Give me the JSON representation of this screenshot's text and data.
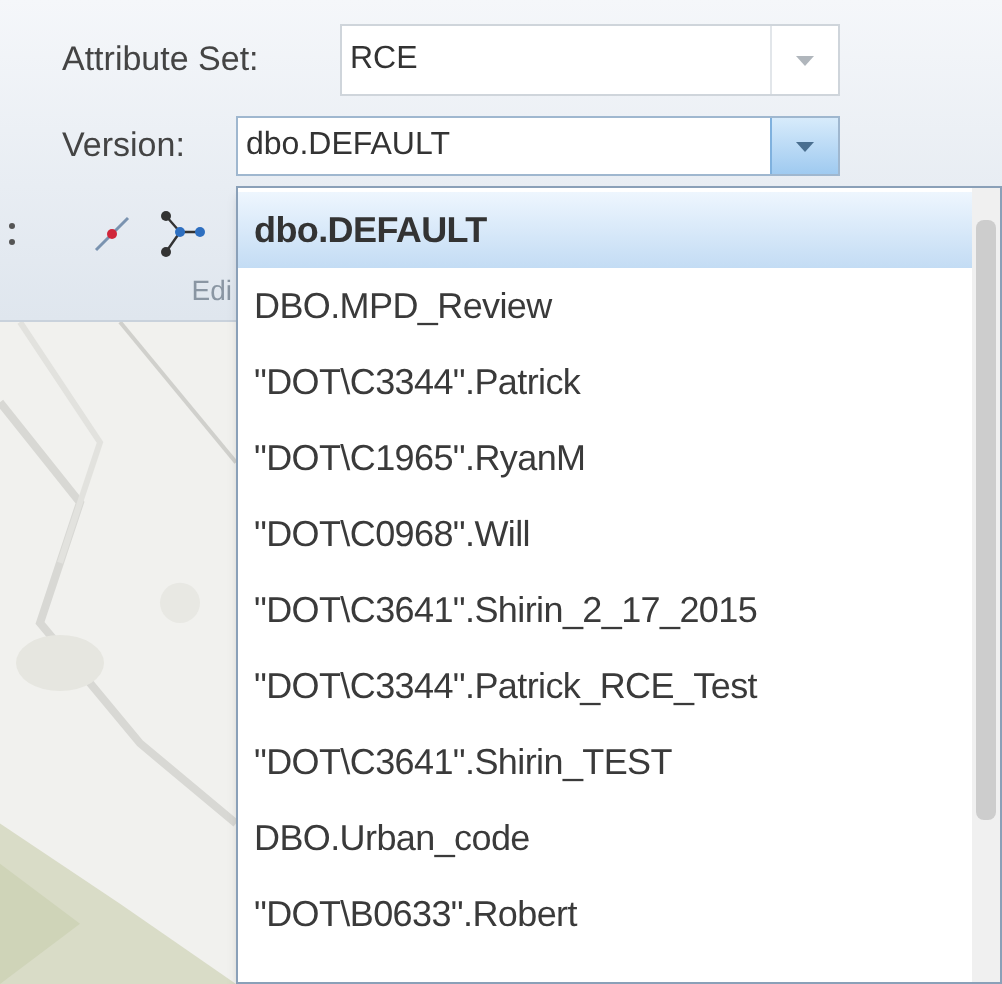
{
  "attribute_set": {
    "label": "Attribute Set:",
    "value": "RCE"
  },
  "version": {
    "label": "Version:",
    "value": "dbo.DEFAULT",
    "expanded": true
  },
  "toolbar": {
    "group_label": "Edi"
  },
  "version_list": [
    {
      "label": "dbo.DEFAULT",
      "selected": true
    },
    {
      "label": "DBO.MPD_Review",
      "selected": false
    },
    {
      "label": "\"DOT\\C3344\".Patrick",
      "selected": false
    },
    {
      "label": "\"DOT\\C1965\".RyanM",
      "selected": false
    },
    {
      "label": "\"DOT\\C0968\".Will",
      "selected": false
    },
    {
      "label": "\"DOT\\C3641\".Shirin_2_17_2015",
      "selected": false
    },
    {
      "label": "\"DOT\\C3344\".Patrick_RCE_Test",
      "selected": false
    },
    {
      "label": "\"DOT\\C3641\".Shirin_TEST",
      "selected": false
    },
    {
      "label": "DBO.Urban_code",
      "selected": false
    },
    {
      "label": "\"DOT\\B0633\".Robert",
      "selected": false
    }
  ]
}
